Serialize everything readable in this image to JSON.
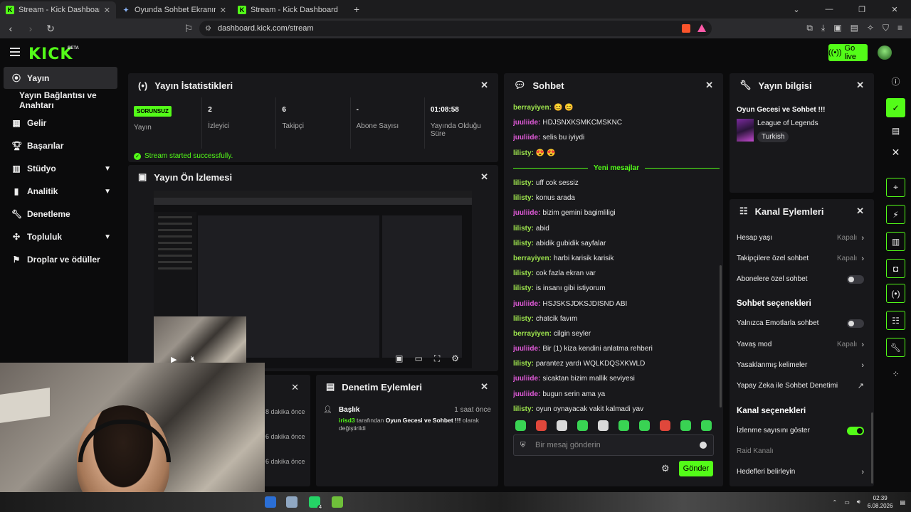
{
  "browser": {
    "tabs": [
      {
        "title": "Stream - Kick Dashboard",
        "active": true
      },
      {
        "title": "Oyunda Sohbet Ekranını Görünür Tut"
      },
      {
        "title": "Stream - Kick Dashboard"
      }
    ],
    "url": "dashboard.kick.com/stream"
  },
  "header": {
    "logo": "KICK",
    "beta": "BETA",
    "go_live": "Go live"
  },
  "sidebar": {
    "items": [
      {
        "label": "Yayın",
        "icon": "broadcast-icon"
      },
      {
        "label": "Yayın Bağlantısı ve Anahtarı"
      },
      {
        "label": "Gelir",
        "icon": "revenue-icon"
      },
      {
        "label": "Başarılar",
        "icon": "trophy-icon"
      },
      {
        "label": "Stüdyo",
        "icon": "studio-icon"
      },
      {
        "label": "Analitik",
        "icon": "analytics-icon"
      },
      {
        "label": "Denetleme",
        "icon": "wrench-icon"
      },
      {
        "label": "Topluluk",
        "icon": "community-icon"
      },
      {
        "label": "Droplar ve ödüller",
        "icon": "gift-icon"
      }
    ]
  },
  "stats_panel": {
    "title": "Yayın İstatistikleri",
    "items": [
      {
        "value": "SORUNSUZ",
        "label": "Yayın"
      },
      {
        "value": "2",
        "label": "İzleyici"
      },
      {
        "value": "6",
        "label": "Takipçi"
      },
      {
        "value": "-",
        "label": "Abone Sayısı"
      },
      {
        "value": "01:08:58",
        "label": "Yayında Olduğu Süre"
      }
    ],
    "status": "Stream started successfully."
  },
  "preview_panel": {
    "title": "Yayın Ön İzlemesi"
  },
  "recent_times": [
    "8 dakika önce",
    "6 dakika önce",
    "6 dakika önce"
  ],
  "audit_panel": {
    "title": "Denetim Eylemleri",
    "entry_title": "Başlık",
    "entry_time": "1 saat önce",
    "entry_user": "irisd3",
    "entry_mid": " tarafından ",
    "entry_stream": "Oyun Gecesi ve Sohbet !!!",
    "entry_end": " olarak değiştirildi"
  },
  "chat": {
    "title": "Sohbet",
    "messages_before": [
      {
        "user": "berrayiyen",
        "text": "😊 😊",
        "color": "g"
      },
      {
        "user": "juuliide",
        "text": "HDJSNXKSMKCMSKNC",
        "color": "p"
      },
      {
        "user": "juuliide",
        "text": "selis bu iyiydi",
        "color": "p"
      },
      {
        "user": "lilisty",
        "text": "😍 😍",
        "color": "g"
      }
    ],
    "separator": "Yeni mesajlar",
    "messages_after": [
      {
        "user": "lilisty",
        "text": "uff cok sessiz",
        "color": "g"
      },
      {
        "user": "lilisty",
        "text": "konus arada",
        "color": "g"
      },
      {
        "user": "juuliide",
        "text": "bizim gemini bagimliligi",
        "color": "p"
      },
      {
        "user": "lilisty",
        "text": "abid",
        "color": "g"
      },
      {
        "user": "lilisty",
        "text": "abidik gubidik sayfalar",
        "color": "g"
      },
      {
        "user": "berrayiyen",
        "text": "harbi karisik karisik",
        "color": "g"
      },
      {
        "user": "lilisty",
        "text": "cok fazla ekran var",
        "color": "g"
      },
      {
        "user": "lilisty",
        "text": "is insanı gibi istiyorum",
        "color": "g"
      },
      {
        "user": "juuliide",
        "text": "HSJSKSJDKSJDISND ABI",
        "color": "p"
      },
      {
        "user": "lilisty",
        "text": "chatcik favım",
        "color": "g"
      },
      {
        "user": "berrayiyen",
        "text": "cilgin seyler",
        "color": "g"
      },
      {
        "user": "juuliide",
        "text": "Bir (1) kiza kendini anlatma rehberi",
        "color": "p"
      },
      {
        "user": "lilisty",
        "text": "parantez yardı WQLKDQSXKWLD",
        "color": "g"
      },
      {
        "user": "juuliide",
        "text": "sicaktan bizim mallik seviyesi",
        "color": "p"
      },
      {
        "user": "juuliide",
        "text": "bugun serin ama ya",
        "color": "p"
      },
      {
        "user": "lilisty",
        "text": "oyun oynayacak vakit kalmadi yav",
        "color": "g"
      }
    ],
    "placeholder": "Bir mesaj gönderin",
    "send": "Gönder"
  },
  "info_panel": {
    "title": "Yayın bilgisi",
    "stream_title": "Oyun Gecesi ve Sohbet !!!",
    "game": "League of Legends",
    "language": "Turkish"
  },
  "channel_panel": {
    "title": "Kanal Eylemleri",
    "rows": [
      {
        "label": "Hesap yaşı",
        "value": "Kapalı",
        "kind": "chevron"
      },
      {
        "label": "Takipçilere özel sohbet",
        "value": "Kapalı",
        "kind": "chevron"
      },
      {
        "label": "Abonelere özel sohbet",
        "kind": "toggle",
        "on": false
      },
      {
        "label": "Sohbet seçenekleri",
        "kind": "heading"
      },
      {
        "label": "Yalnızca Emotlarla sohbet",
        "kind": "toggle",
        "on": false
      },
      {
        "label": "Yavaş mod",
        "value": "Kapalı",
        "kind": "chevron"
      },
      {
        "label": "Yasaklanmış kelimeler",
        "kind": "chevron"
      },
      {
        "label": "Yapay Zeka ile Sohbet Denetimi",
        "kind": "external"
      },
      {
        "label": "Kanal seçenekleri",
        "kind": "heading"
      },
      {
        "label": "İzlenme sayısını göster",
        "kind": "toggle",
        "on": true
      },
      {
        "label": "Raid Kanalı",
        "kind": "muted"
      },
      {
        "label": "Hedefleri belirleyin",
        "kind": "chevron"
      }
    ]
  },
  "taskbar": {
    "time": "02:39",
    "date": "6.08.2026",
    "whatsapp_badge": "4"
  },
  "colors": {
    "accent": "#53fc18",
    "panel": "#18181b",
    "background": "#0b0b0c"
  }
}
